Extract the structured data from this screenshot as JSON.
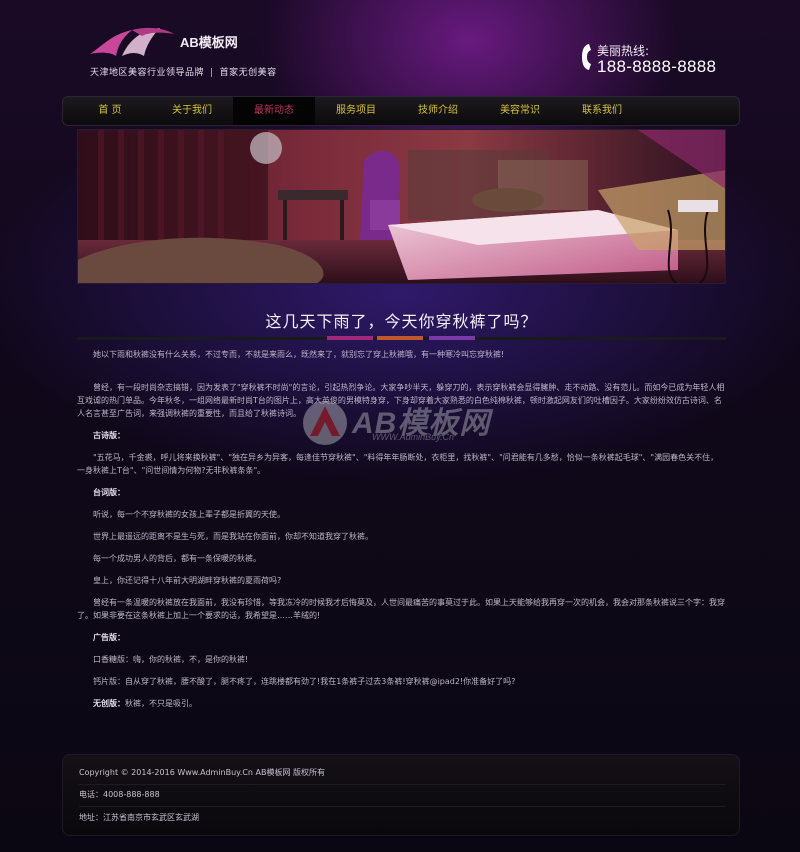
{
  "header": {
    "logo_text": "AB模板网",
    "slogan_left": "天津地区美容行业领导品牌",
    "slogan_right": "首家无创美容",
    "hotline_label": "美丽热线:",
    "hotline_number": "188-8888-8888"
  },
  "nav": {
    "items": [
      "首 页",
      "关于我们",
      "最新动态",
      "服务项目",
      "技师介绍",
      "美容常识",
      "联系我们"
    ],
    "active_index": 2
  },
  "article": {
    "title": "这几天下雨了，今天你穿秋裤了吗？",
    "intro": "她以下雨和秋裤没有什么关系，不过专而，不就是来雨么，既然来了，就别忘了穿上秋裤哦，有一种寒冷叫忘穿秋裤!",
    "paragraph_1": "曾经，有一段时尚杂志搞错，因为发表了\"穿秋裤不时尚\"的言论，引起热烈争论。大家争吵半天，躲穿刀的，表示穿秋裤会显得臃肿、走不动路、没有范儿。而如今已成为年轻人相互戏谑的热门单品。今年秋冬，一组网络最新时尚T台的图片上，高大英俊的男模特身穿，下身却穿着大家熟悉的白色纯棉秋裤，顿时激起网友们的吐槽因子。大家纷纷效仿古诗词、名人名言甚至广告词，来强调秋裤的重要性，而且给了秋裤诗词。",
    "heading_1": "古诗版：",
    "paragraph_2": "\"五花马，千金裘，呼儿将来换秋裤\"、\"独在异乡为异客，每逢佳节穿秋裤\"、\"料得年年肠断处，衣柜里，找秋裤\"、\"问君能有几多愁，恰似一条秋裤起毛球\"、\"满园春色关不住，一身秋裤上T台\"、\"问世间情为何物?无非秋裤条条\"。",
    "heading_2": "台词版：",
    "line_1": "听说，每一个不穿秋裤的女孩上辈子都是折翼的天使。",
    "line_2": "世界上最遥远的距离不是生与死，而是我站在你面前，你却不知道我穿了秋裤。",
    "line_3": "每一个成功男人的背后，都有一条保暖的秋裤。",
    "line_4": "皇上，你还记得十八年前大明湖畔穿秋裤的夏雨荷吗?",
    "paragraph_3": "曾经有一条温暖的秋裤放在我面前，我没有珍惜，等我冻冷的时候我才后悔莫及，人世间最痛苦的事莫过于此。如果上天能够给我再穿一次的机会，我会对那条秋裤说三个字：我穿了。如果非要在这条秋裤上加上一个要求的话，我希望是……羊绒的!",
    "heading_3": "广告版：",
    "ad_1": "口香糖版：嗨，你的秋裤，不，是你的秋裤!",
    "ad_2": "钙片版：自从穿了秋裤，腰不酸了，腿不疼了，连跳楼都有劲了!我在1条裤子过去3条裤!穿秋裤@ipad2!你准备好了吗?",
    "heading_4": "无创版：",
    "ad_3_text": "秋裤，不只是吸引。"
  },
  "watermark": {
    "brand": "AB模板网",
    "url": "WWW.AdminBuy.Cn"
  },
  "footer": {
    "copyright": "Copyright © 2014-2016 Www.AdminBuy.Cn AB模板网 版权所有",
    "phone": "电话：4008-888-888",
    "address": "地址：江苏省南京市玄武区玄武湖"
  },
  "colors": {
    "nav_text": "#d8c23a",
    "nav_active": "#b8365a",
    "title_rule_magenta": "#a0287a",
    "title_rule_orange": "#c0562a",
    "title_rule_purple": "#7a3aa8"
  }
}
